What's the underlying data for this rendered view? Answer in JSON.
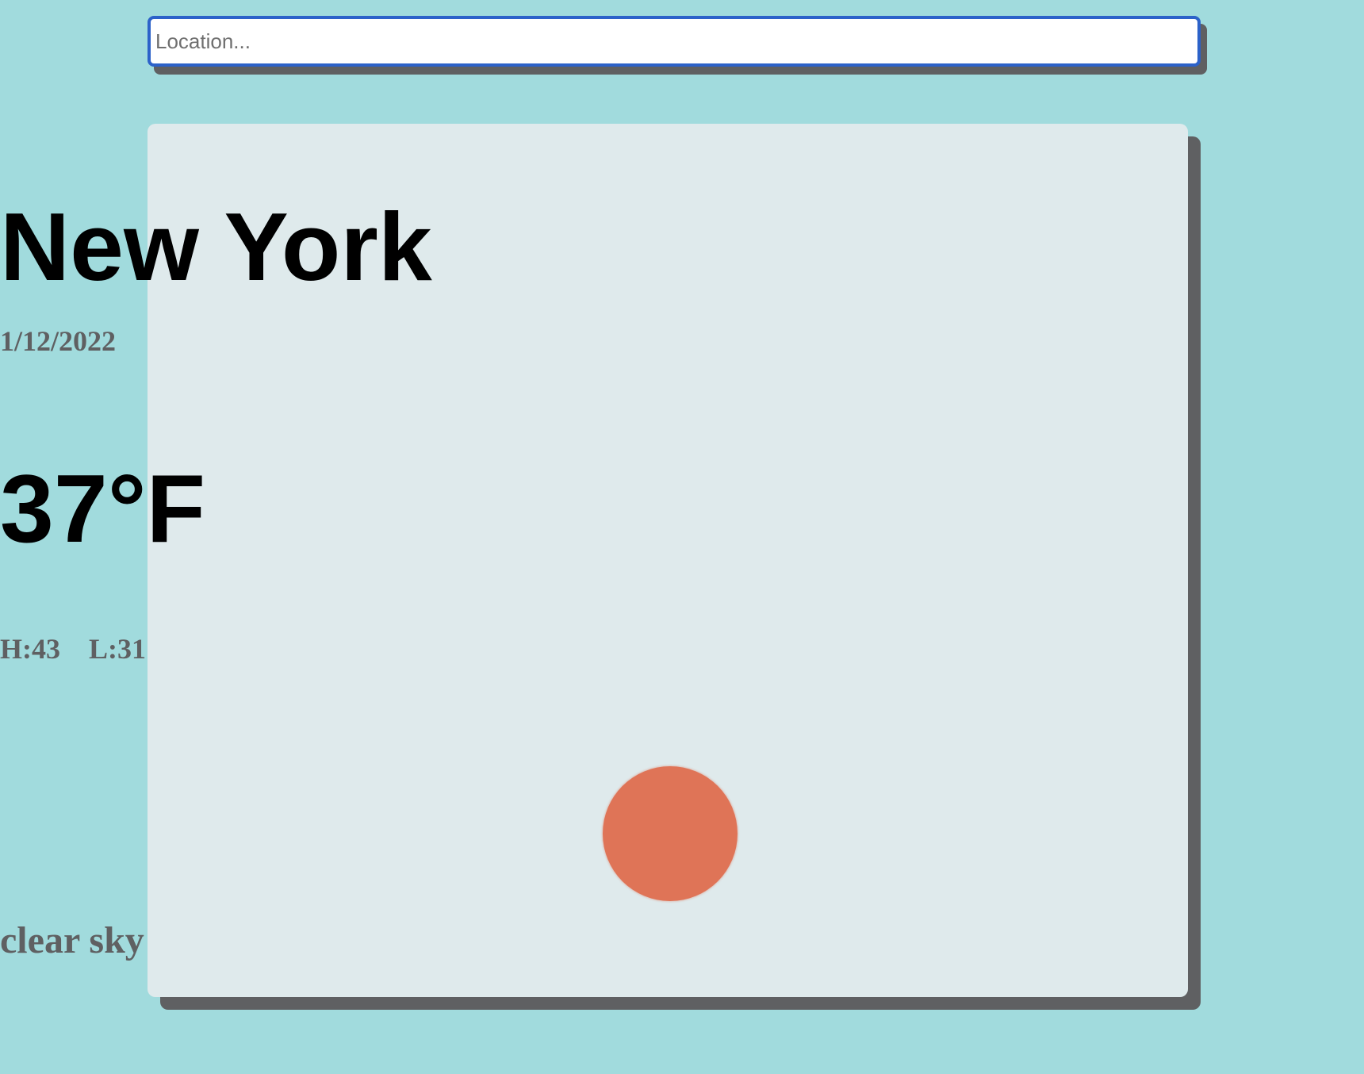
{
  "search": {
    "placeholder": "Location...",
    "value": ""
  },
  "weather": {
    "city": "New York",
    "date": "1/12/2022",
    "temperature": "37°F",
    "high": "H:43",
    "low": "L:31",
    "condition_icon": "sun-icon",
    "condition_color": "#df7457",
    "description": "clear sky"
  },
  "colors": {
    "background": "#a1dbdd",
    "card": "#dfeaec",
    "shadow": "#5f6062",
    "input_border": "#2c62c9"
  }
}
